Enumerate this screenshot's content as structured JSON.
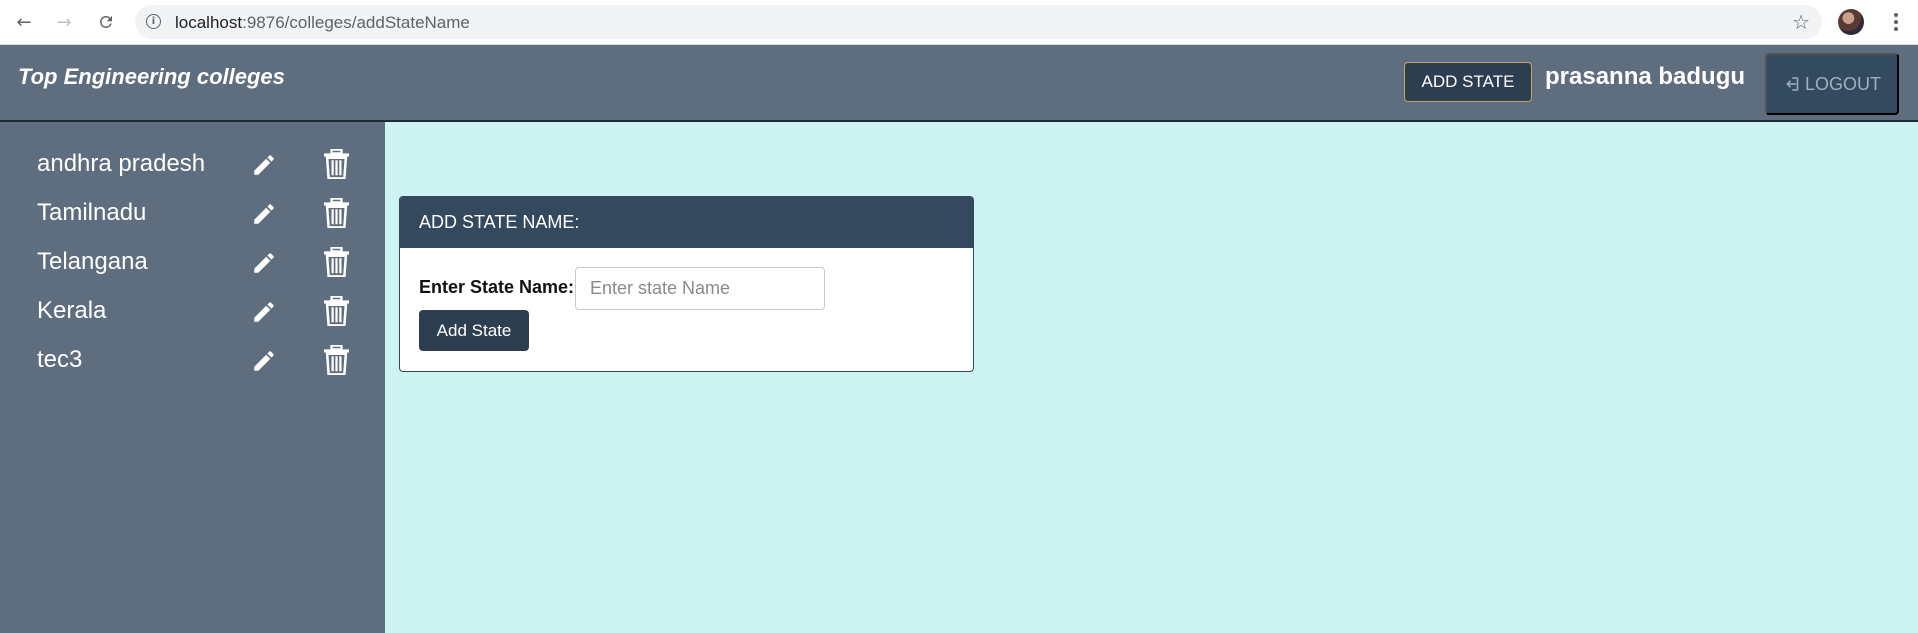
{
  "browser": {
    "url_host": "localhost",
    "url_path": ":9876/colleges/addStateName"
  },
  "header": {
    "brand": "Top Engineering colleges",
    "add_state_label": "ADD STATE",
    "username": "prasanna badugu",
    "logout_label": "LOGOUT"
  },
  "sidebar": {
    "items": [
      {
        "label": "andhra pradesh"
      },
      {
        "label": "Tamilnadu"
      },
      {
        "label": "Telangana"
      },
      {
        "label": "Kerala"
      },
      {
        "label": "tec3"
      }
    ]
  },
  "form": {
    "title": "ADD STATE NAME:",
    "field_label": "Enter State Name:",
    "placeholder": "Enter state Name",
    "submit_label": "Add State"
  },
  "colors": {
    "header_bg": "#5e6e7e",
    "accent_dark": "#2c3e50",
    "main_bg": "#cdf3f2"
  },
  "icons": {
    "back": "arrow-left-icon",
    "forward": "arrow-right-icon",
    "reload": "reload-icon",
    "info": "info-icon",
    "bookmark": "star-icon",
    "edit": "pencil-icon",
    "delete": "trash-icon",
    "logout": "login-icon"
  }
}
